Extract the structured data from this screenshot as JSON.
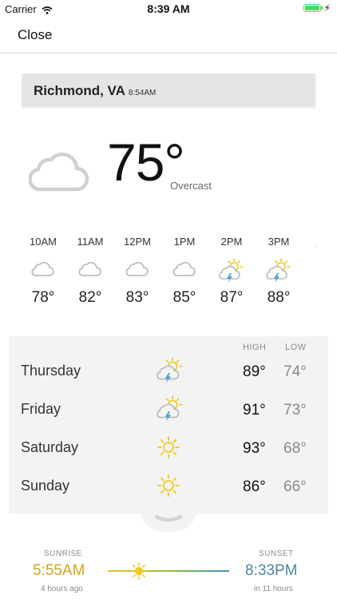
{
  "status_bar": {
    "carrier": "Carrier",
    "time": "8:39 AM",
    "battery_level": 1.0,
    "battery_color": "#4cd964"
  },
  "nav": {
    "close_label": "Close"
  },
  "location": {
    "name": "Richmond, VA",
    "local_time": "8:54AM"
  },
  "current": {
    "temp": "75°",
    "condition": "Overcast",
    "icon": "cloud-icon"
  },
  "hourly": [
    {
      "time": "10AM",
      "icon": "cloud-icon",
      "temp": "78°"
    },
    {
      "time": "11AM",
      "icon": "cloud-icon",
      "temp": "82°"
    },
    {
      "time": "12PM",
      "icon": "cloud-icon",
      "temp": "83°"
    },
    {
      "time": "1PM",
      "icon": "cloud-icon",
      "temp": "85°"
    },
    {
      "time": "2PM",
      "icon": "thunderstorm-sun-icon",
      "temp": "87°"
    },
    {
      "time": "3PM",
      "icon": "thunderstorm-sun-icon",
      "temp": "88°"
    }
  ],
  "daily": {
    "high_label": "HIGH",
    "low_label": "LOW",
    "days": [
      {
        "day": "Thursday",
        "icon": "thunderstorm-sun-icon",
        "high": "89°",
        "low": "74°"
      },
      {
        "day": "Friday",
        "icon": "thunderstorm-sun-icon",
        "high": "91°",
        "low": "73°"
      },
      {
        "day": "Saturday",
        "icon": "sun-icon",
        "high": "93°",
        "low": "68°"
      },
      {
        "day": "Sunday",
        "icon": "sun-icon",
        "high": "86°",
        "low": "66°"
      }
    ]
  },
  "sun": {
    "sunrise_label": "SUNRISE",
    "sunrise_time": "5:55AM",
    "sunrise_relative": "4 hours ago",
    "sunset_label": "SUNSET",
    "sunset_time": "8:33PM",
    "sunset_relative": "in 11 hours",
    "colors": {
      "sunrise": "#cfa51e",
      "sunset": "#4a86a8",
      "sun": "#f2c81e"
    }
  }
}
